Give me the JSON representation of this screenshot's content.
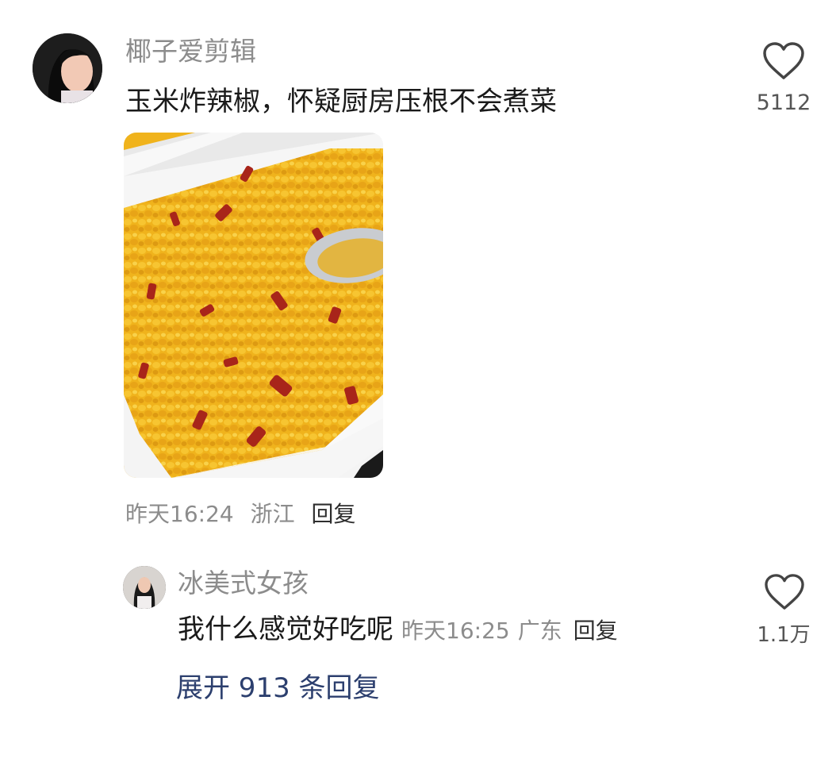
{
  "comment": {
    "username": "椰子爱剪辑",
    "text": "玉米炸辣椒，怀疑厨房压根不会煮菜",
    "like_count": "5112",
    "time": "昨天16:24",
    "location": "浙江",
    "reply_label": "回复",
    "photo_desc": "fried corn with chili peppers in white container"
  },
  "reply": {
    "username": "冰美式女孩",
    "text": "我什么感觉好吃呢",
    "time": "昨天16:25",
    "location": "广东",
    "reply_label": "回复",
    "like_count": "1.1万"
  },
  "expand_label": "展开 913 条回复",
  "colors": {
    "username": "#8c8c8c",
    "text": "#1a1a1a",
    "link": "#2c3f6e",
    "background": "#ffffff"
  }
}
